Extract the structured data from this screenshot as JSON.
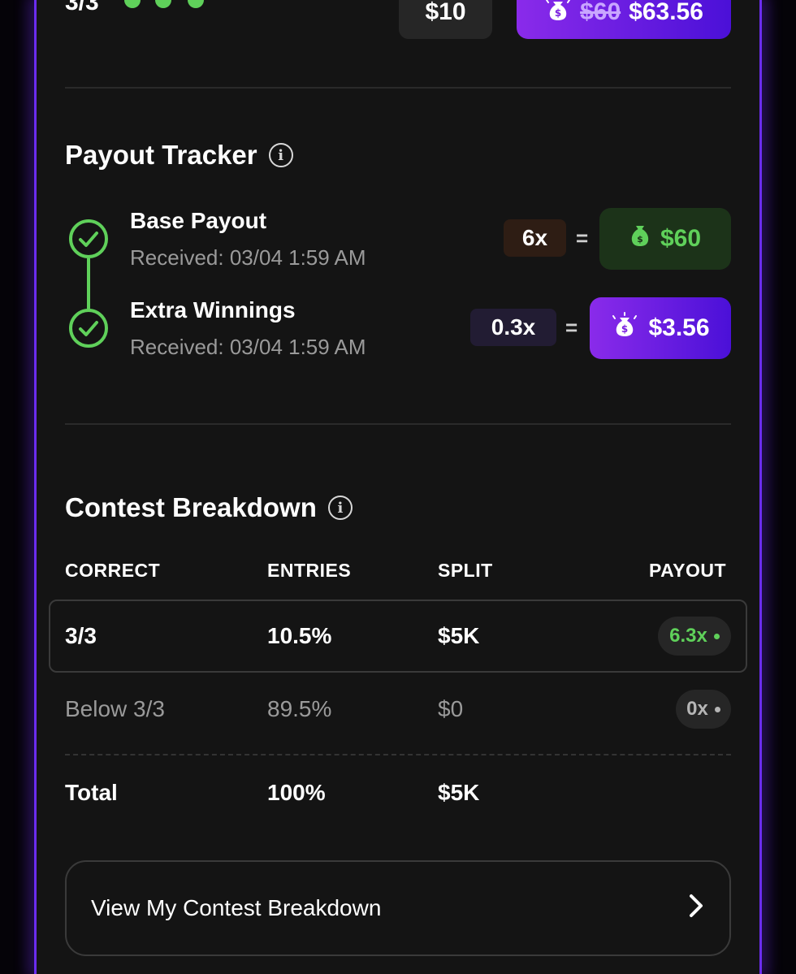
{
  "top_row": {
    "correct": "3/3",
    "stake": "$10",
    "original_payout": "$60",
    "boosted_payout": "$63.56"
  },
  "payout_tracker": {
    "title": "Payout Tracker",
    "steps": [
      {
        "title": "Base Payout",
        "received": "Received: 03/04 1:59 AM",
        "multiplier": "6x",
        "equals": "=",
        "amount": "$60"
      },
      {
        "title": "Extra Winnings",
        "received": "Received: 03/04 1:59 AM",
        "multiplier": "0.3x",
        "equals": "=",
        "amount": "$3.56"
      }
    ]
  },
  "contest_breakdown": {
    "title": "Contest Breakdown",
    "headers": [
      "CORRECT",
      "ENTRIES",
      "SPLIT",
      "PAYOUT"
    ],
    "rows": [
      {
        "correct": "3/3",
        "entries": "10.5%",
        "split": "$5K",
        "payout": "6.3x"
      },
      {
        "correct": "Below 3/3",
        "entries": "89.5%",
        "split": "$0",
        "payout": "0x"
      }
    ],
    "total": {
      "label": "Total",
      "entries": "100%",
      "split": "$5K"
    }
  },
  "cta": {
    "label": "View My Contest Breakdown"
  },
  "colors": {
    "accent_green": "#5fd05a",
    "accent_purple": "#8a2bea",
    "background": "#141414"
  }
}
